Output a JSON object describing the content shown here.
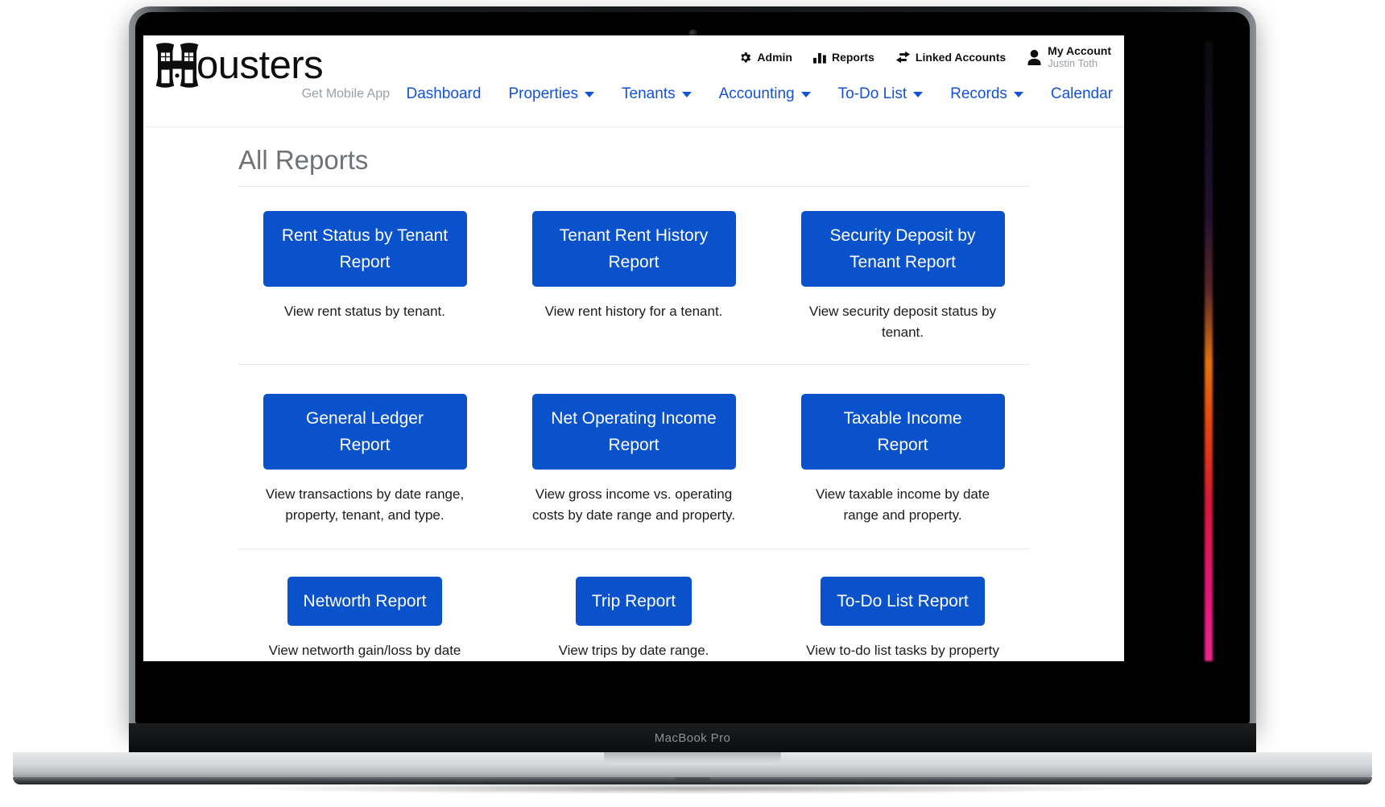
{
  "device": {
    "label": "MacBook Pro"
  },
  "header": {
    "brand_name": "ousters",
    "brand_logo_letter": "H",
    "brand_subtitle": "Get Mobile App",
    "util_nav": [
      {
        "label": "Admin",
        "icon": "gear-icon"
      },
      {
        "label": "Reports",
        "icon": "bar-chart-icon"
      },
      {
        "label": "Linked Accounts",
        "icon": "exchange-arrows-icon"
      }
    ],
    "account": {
      "title": "My Account",
      "user": "Justin Toth",
      "icon": "user-avatar-icon"
    },
    "main_nav": [
      {
        "label": "Dashboard",
        "has_caret": false
      },
      {
        "label": "Properties",
        "has_caret": true
      },
      {
        "label": "Tenants",
        "has_caret": true
      },
      {
        "label": "Accounting",
        "has_caret": true
      },
      {
        "label": "To-Do List",
        "has_caret": true
      },
      {
        "label": "Records",
        "has_caret": true
      },
      {
        "label": "Calendar",
        "has_caret": false
      }
    ]
  },
  "page": {
    "title": "All Reports"
  },
  "reports": {
    "row1": [
      {
        "button": "Rent Status by Tenant Report",
        "desc": "View rent status by tenant."
      },
      {
        "button": "Tenant Rent History Report",
        "desc": "View rent history for a tenant."
      },
      {
        "button": "Security Deposit by Tenant Report",
        "desc": "View security deposit status by tenant."
      }
    ],
    "row2": [
      {
        "button": "General Ledger Report",
        "desc": "View transactions by date range, property, tenant, and type."
      },
      {
        "button": "Net Operating Income Report",
        "desc": "View gross income vs. operating costs by date range and property."
      },
      {
        "button": "Taxable Income Report",
        "desc": "View taxable income by date range and property."
      }
    ],
    "row3": [
      {
        "button": "Networth Report",
        "desc": "View networth gain/loss by date range and property."
      },
      {
        "button": "Trip Report",
        "desc": "View trips by date range."
      },
      {
        "button": "To-Do List Report",
        "desc": "View to-do list tasks by property and tenant."
      }
    ]
  },
  "colors": {
    "primary_blue": "#0a52cc",
    "nav_link_blue": "#1352d8",
    "title_gray": "#6f7276",
    "muted_gray": "#9aa0a6"
  }
}
